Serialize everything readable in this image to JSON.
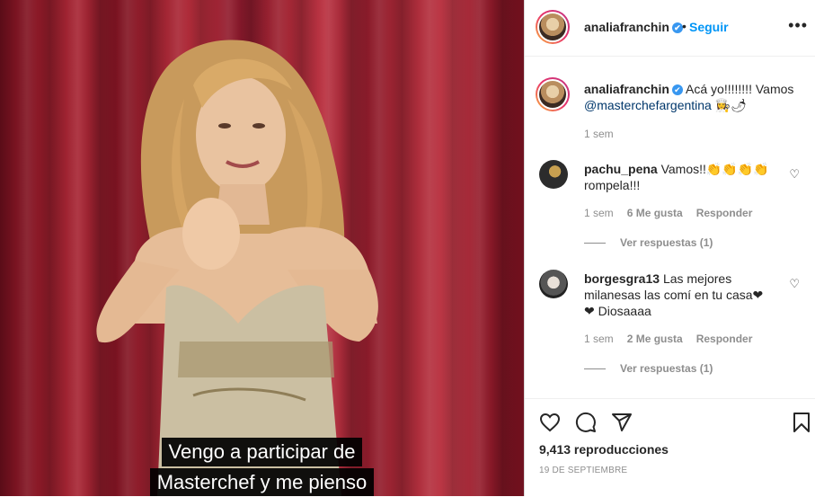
{
  "video": {
    "subtitle_line1": "Vengo a participar de",
    "subtitle_line2": "Masterchef y me pienso"
  },
  "header": {
    "username": "analiafranchin",
    "verified_icon": "✔",
    "separator": "•",
    "follow_label": "Seguir",
    "more_icon": "•••"
  },
  "caption": {
    "username": "analiafranchin",
    "text": "Acá yo!!!!!!!! Vamos",
    "mention": "@masterchefargentina",
    "emoji": "👩‍🍳🌶",
    "time": "1 sem"
  },
  "comments": [
    {
      "username": "pachu_pena",
      "text_line1": "Vamos!!👏👏👏👏",
      "text_line2": "rompela!!!",
      "time": "1 sem",
      "likes": "6 Me gusta",
      "reply": "Responder",
      "view_replies": "Ver respuestas (1)"
    },
    {
      "username": "borgesgra13",
      "text_line1": "Las mejores",
      "text_line2": "milanesas las comí en tu casa❤",
      "text_line3": "❤ Diosaaaa",
      "time": "1 sem",
      "likes": "2 Me gusta",
      "reply": "Responder",
      "view_replies": "Ver respuestas (1)"
    }
  ],
  "footer": {
    "views": "9,413 reproducciones",
    "date": "19 DE SEPTIEMBRE"
  },
  "icons": {
    "like": "heart-icon",
    "comment": "comment-icon",
    "share": "share-icon",
    "save": "bookmark-icon"
  },
  "colors": {
    "link_blue": "#0095f6",
    "verified_blue": "#3897f0",
    "curtain_red": "#a82836"
  }
}
